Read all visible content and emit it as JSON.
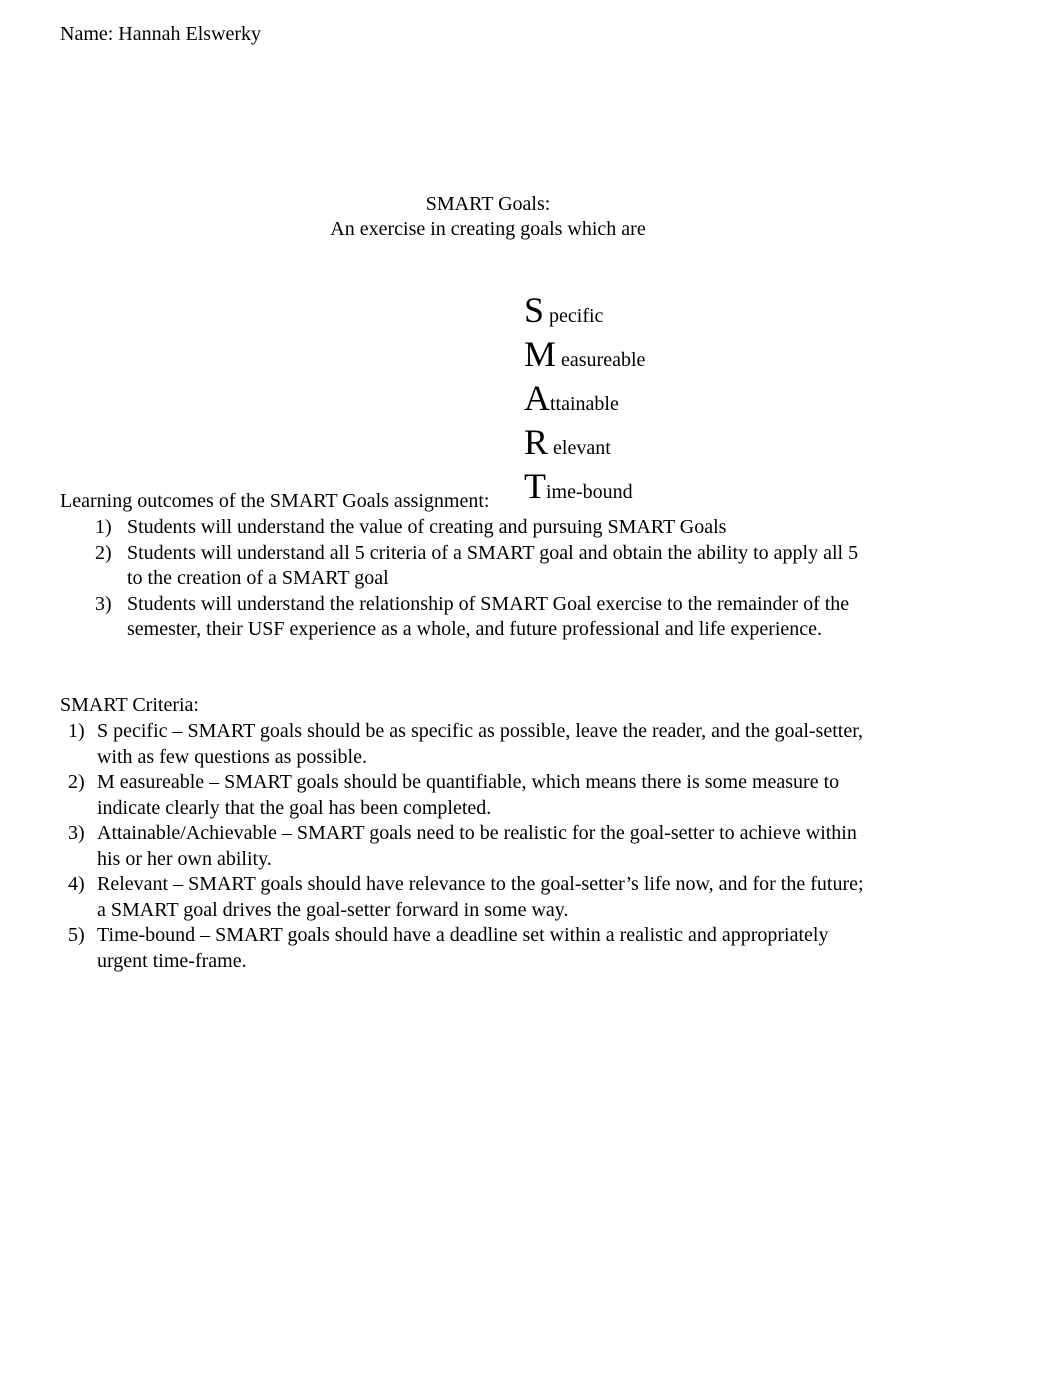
{
  "document": {
    "name_line": "Name: Hannah Elswerky",
    "title": {
      "line1": "SMART Goals:",
      "line2": "An exercise in creating goals which are"
    },
    "acronym": [
      {
        "capital": "S",
        "rest": " pecific"
      },
      {
        "capital": "M",
        "rest": " easureable"
      },
      {
        "capital": "A",
        "rest": "ttainable"
      },
      {
        "capital": "R",
        "rest": " elevant"
      },
      {
        "capital": "T",
        "rest": "ime-bound"
      }
    ],
    "outcomes": {
      "heading": "Learning outcomes of the SMART Goals assignment:",
      "items": [
        {
          "marker": "1)",
          "text": "Students will understand the value of creating and pursuing SMART Goals"
        },
        {
          "marker": "2)",
          "text": "Students will understand all 5 criteria of a SMART goal and obtain the ability to apply all 5 to the creation of a SMART goal"
        },
        {
          "marker": "3)",
          "text": "Students will understand the relationship of SMART Goal exercise to the remainder of the semester, their USF experience as a whole, and future professional and life experience."
        }
      ]
    },
    "criteria": {
      "heading": "SMART Criteria:",
      "items": [
        {
          "marker": "1)",
          "text": "S pecific – SMART goals should be as specific as possible, leave the reader, and the goal-setter, with as few questions as possible."
        },
        {
          "marker": "2)",
          "text": "M easureable – SMART goals should be quantifiable, which means there is some measure to indicate clearly that the goal has been completed."
        },
        {
          "marker": "3)",
          "text": "Attainable/Achievable – SMART goals need to be realistic for the goal-setter to achieve within his or her own ability."
        },
        {
          "marker": "4)",
          "text": "Relevant – SMART goals should have relevance to the goal-setter’s life now, and for the future; a SMART goal drives the goal-setter forward in some way."
        },
        {
          "marker": "5)",
          "text": "Time-bound – SMART goals should have a deadline set within a realistic and appropriately urgent time-frame."
        }
      ]
    },
    "colors": {
      "page_background": "#ffffff",
      "text": "#000000"
    }
  }
}
